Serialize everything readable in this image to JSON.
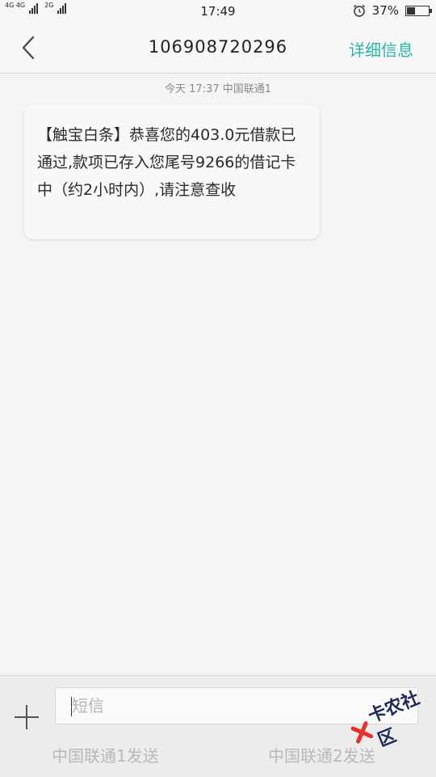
{
  "status_bar": {
    "network_1": "4G 4G",
    "network_2": "2G",
    "time": "17:49",
    "battery": "37%",
    "battery_level": 0.37,
    "icons": [
      "signal-icon",
      "alarm-icon",
      "battery-icon"
    ]
  },
  "header": {
    "title": "106908720296",
    "detail_button": "详细信息",
    "back_icon": "chevron-left-icon",
    "accent_color": "#2bb5a8"
  },
  "conversation": {
    "timestamp": "今天  17:37  中国联通1",
    "messages": [
      {
        "text": "【触宝白条】恭喜您的403.0元借款已通过,款项已存入您尾号9266的借记卡中（约2小时内）,请注意查收"
      }
    ]
  },
  "composer": {
    "add_icon": "plus-icon",
    "input_placeholder": "短信",
    "send_sim1": "中国联通1发送",
    "send_sim2": "中国联通2发送"
  },
  "watermark": {
    "text": "卡农社区"
  }
}
